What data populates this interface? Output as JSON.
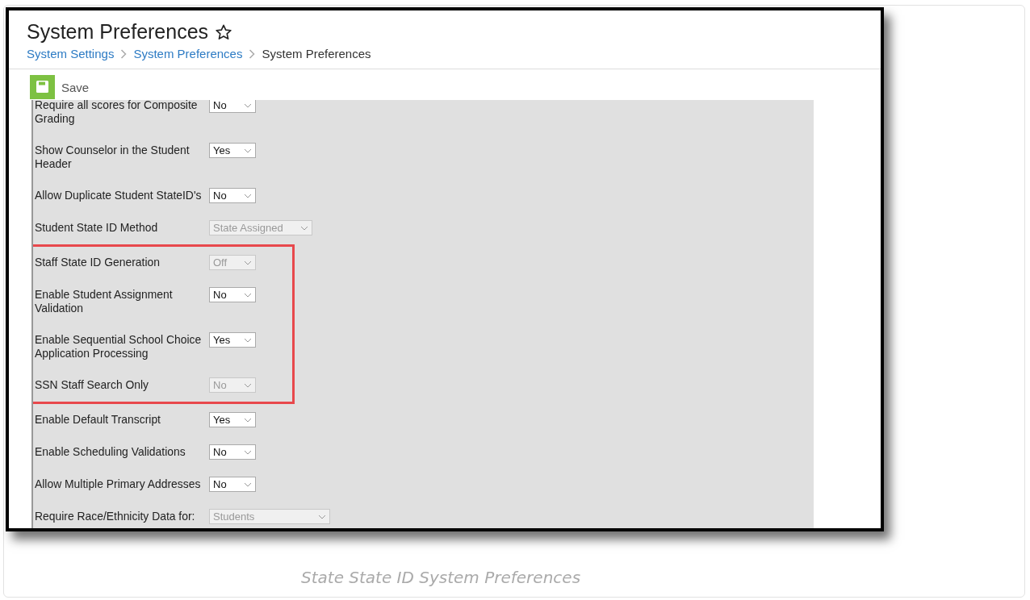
{
  "page": {
    "title": "System Preferences",
    "favorite": false,
    "breadcrumb": [
      {
        "label": "System Settings",
        "link": true
      },
      {
        "label": "System Preferences",
        "link": true
      },
      {
        "label": "System Preferences",
        "link": false
      }
    ]
  },
  "toolbar": {
    "save_label": "Save"
  },
  "settings": [
    {
      "label": "Require all scores for Composite Grading",
      "value": "No",
      "disabled": false,
      "highlighted": false,
      "wide": false
    },
    {
      "label": "Show Counselor in the Student Header",
      "value": "Yes",
      "disabled": false,
      "highlighted": false,
      "wide": false
    },
    {
      "label": "Allow Duplicate Student StateID's",
      "value": "No",
      "disabled": false,
      "highlighted": false,
      "wide": false
    },
    {
      "label": "Student State ID Method",
      "value": "State Assigned",
      "disabled": true,
      "highlighted": false,
      "wide": true
    },
    {
      "label": "Staff State ID Generation",
      "value": "Off",
      "disabled": true,
      "highlighted": true,
      "wide": false
    },
    {
      "label": "Enable Student Assignment Validation",
      "value": "No",
      "disabled": false,
      "highlighted": true,
      "wide": false
    },
    {
      "label": "Enable Sequential School Choice Application Processing",
      "value": "Yes",
      "disabled": false,
      "highlighted": true,
      "wide": false
    },
    {
      "label": "SSN Staff Search Only",
      "value": "No",
      "disabled": true,
      "highlighted": true,
      "wide": false
    },
    {
      "label": "Enable Default Transcript",
      "value": "Yes",
      "disabled": false,
      "highlighted": false,
      "wide": false
    },
    {
      "label": "Enable Scheduling Validations",
      "value": "No",
      "disabled": false,
      "highlighted": false,
      "wide": false
    },
    {
      "label": "Allow Multiple Primary Addresses",
      "value": "No",
      "disabled": false,
      "highlighted": false,
      "wide": false
    },
    {
      "label": "Require Race/Ethnicity Data for:",
      "value": "Students",
      "disabled": true,
      "highlighted": false,
      "wide": true
    }
  ],
  "caption": "State State ID System Preferences"
}
